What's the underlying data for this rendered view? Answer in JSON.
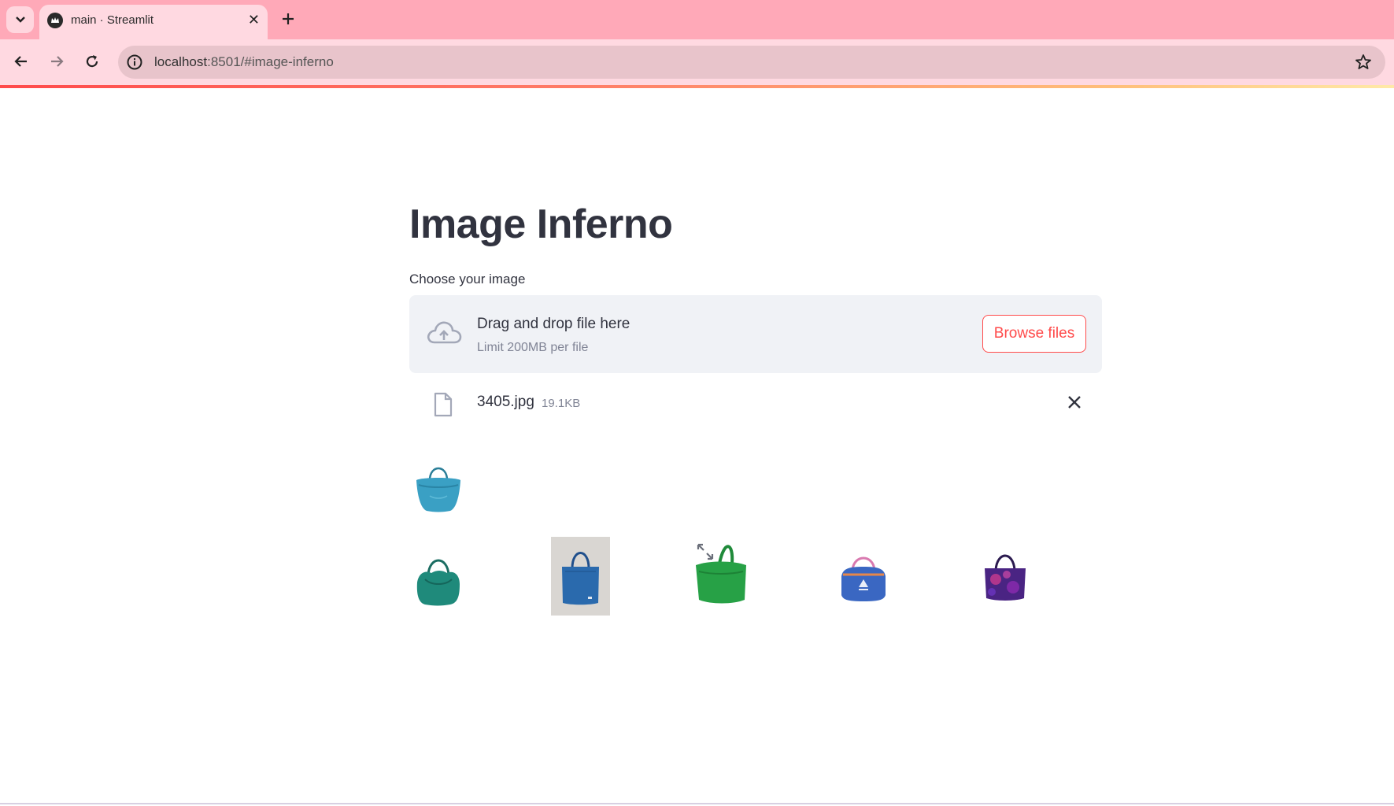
{
  "browser": {
    "tab_title": "main · Streamlit",
    "url_host": "localhost",
    "url_rest": ":8501/#image-inferno",
    "icons": [
      "tab-list-icon",
      "streamlit-favicon-icon",
      "close-icon",
      "plus-icon",
      "back-arrow-icon",
      "forward-arrow-icon",
      "reload-icon",
      "site-info-icon",
      "bookmark-star-icon"
    ]
  },
  "app": {
    "title": "Image Inferno",
    "uploader": {
      "label": "Choose your image",
      "drop_text": "Drag and drop file here",
      "limit_text": "Limit 200MB per file",
      "browse_label": "Browse files"
    },
    "uploaded_file": {
      "name": "3405.jpg",
      "size": "19.1KB"
    },
    "query_image": {
      "icon": "teal-handbag-image"
    },
    "results": [
      {
        "icon": "teal-handbag-image"
      },
      {
        "icon": "blue-tote-image"
      },
      {
        "icon": "green-tote-image"
      },
      {
        "icon": "blue-adidas-duffel-image"
      },
      {
        "icon": "purple-tote-image"
      }
    ]
  },
  "colors": {
    "accent": "#ff4b4b",
    "text": "#31333f",
    "muted": "#808495",
    "dropzone_bg": "#f0f2f6",
    "tabbar_bg": "#ffa9b8",
    "toolbar_bg": "#ffd9e1"
  }
}
